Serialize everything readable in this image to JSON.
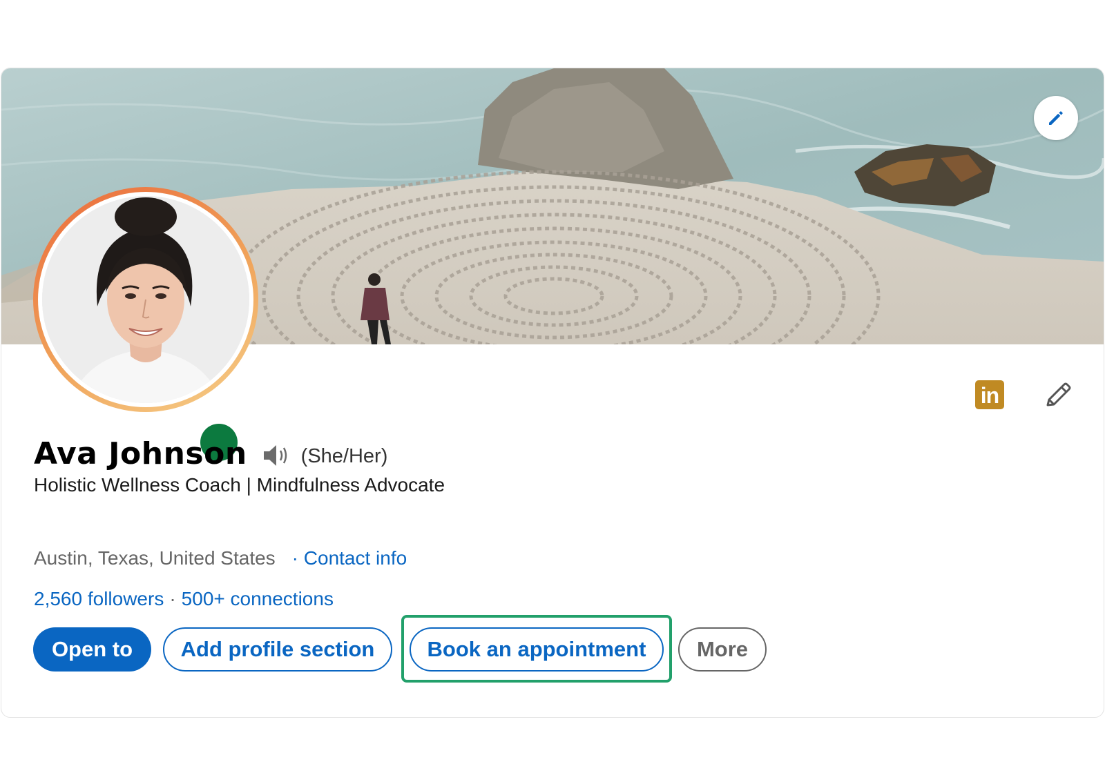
{
  "profile": {
    "name": "Ava Johnson",
    "pronouns": "(She/Her)",
    "headline": "Holistic Wellness Coach | Mindfulness Advocate",
    "location": "Austin, Texas, United States",
    "contact_label": "· Contact info",
    "followers": "2,560 followers",
    "separator": "·",
    "connections": "500+ connections",
    "status": "online",
    "status_color": "#0c7a3f"
  },
  "banner": {
    "description_icon": "banner-image",
    "edit_icon": "pencil-icon"
  },
  "badges": {
    "linkedin_text": "in",
    "linkedin_color": "#c08a23"
  },
  "actions": {
    "open_to": "Open to",
    "add_section": "Add profile section",
    "book": "Book an appointment",
    "more": "More"
  },
  "colors": {
    "accent": "#0a66c2",
    "highlight": "#22a06b"
  }
}
